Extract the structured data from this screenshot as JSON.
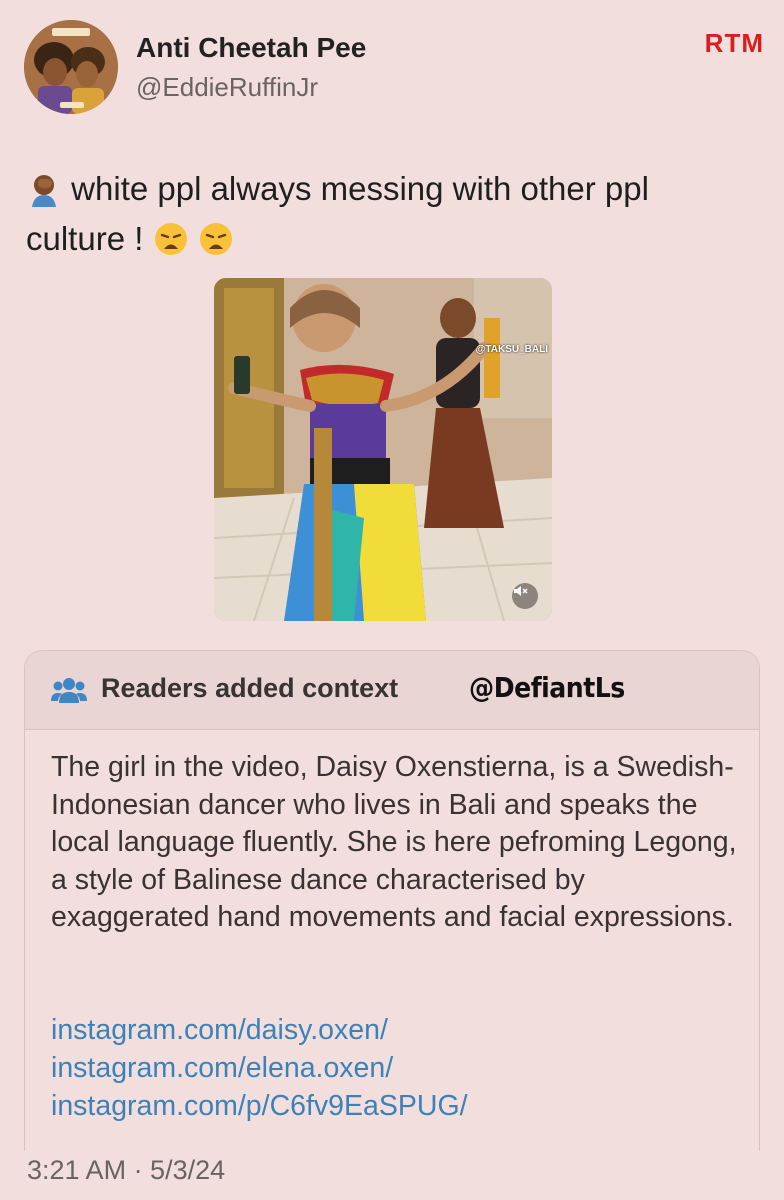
{
  "user": {
    "display_name": "Anti Cheetah Pee",
    "handle": "@EddieRuffinJr",
    "avatar_icon": "avatar-icon"
  },
  "watermark": "RTM",
  "tweet": {
    "text": "white ppl always messing with other ppl culture !",
    "leading_emoji": "facepalm-emoji",
    "trailing_emojis": [
      "weary-face-emoji",
      "weary-face-emoji"
    ]
  },
  "media": {
    "video_tag": "@TAKSU_BALI",
    "mute_icon": "speaker-muted-icon"
  },
  "context": {
    "title": "Readers added context",
    "overlay_tag": "@DefiantLs",
    "body": "The girl in the video, Daisy Oxenstierna, is a Swedish-Indonesian dancer who lives in Bali and speaks the local language fluently. She is here pefroming Legong, a style of Balinese dance characterised by exaggerated hand movements and facial expressions.",
    "links": [
      "instagram.com/daisy.oxen/",
      "instagram.com/elena.oxen/",
      "instagram.com/p/C6fv9EaSPUG/"
    ]
  },
  "timestamp": "3:21 AM · 5/3/24",
  "colors": {
    "background": "#f3dede",
    "link": "#3b82b8",
    "watermark": "#d81e1e"
  }
}
